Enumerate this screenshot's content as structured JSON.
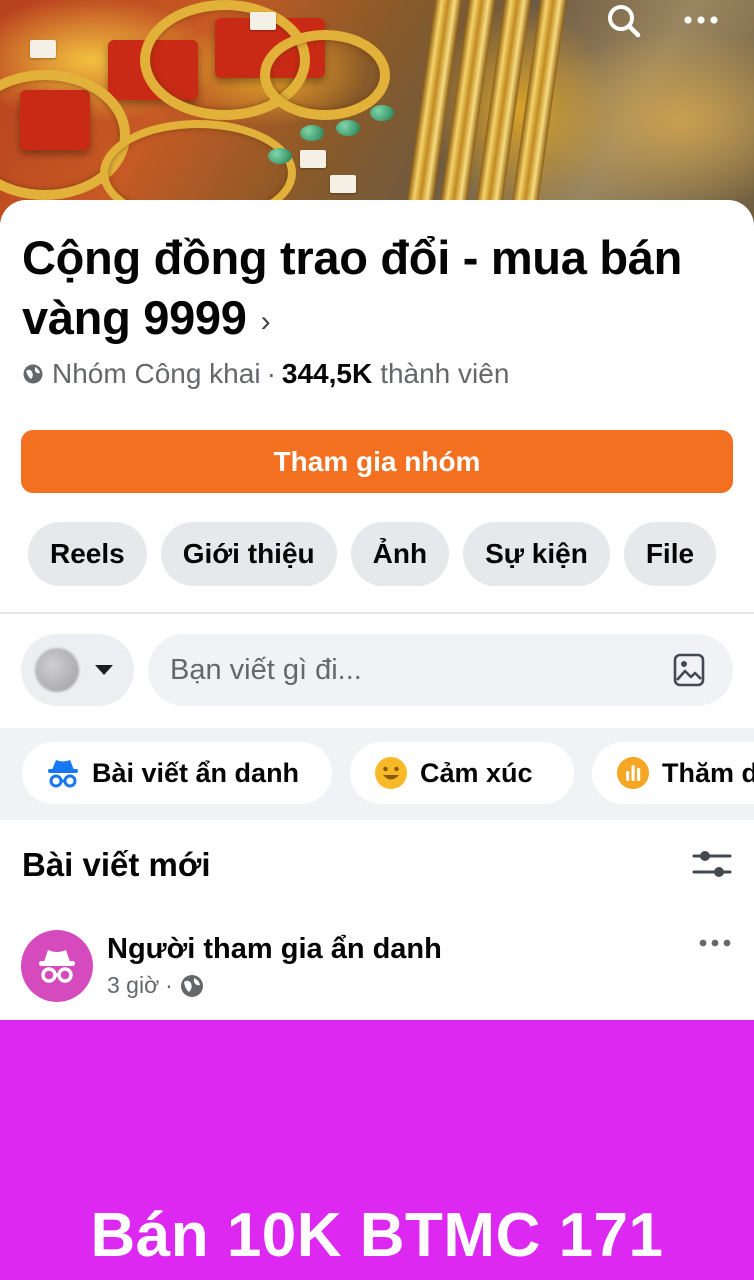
{
  "cover": {
    "alt": "gold jewelry photo"
  },
  "group": {
    "title_line1": "Cộng đồng trao đổi - mua bán",
    "title_line2": "vàng 9999",
    "chevron": "›",
    "privacy": "Nhóm Công khai",
    "separator": "·",
    "member_count": "344,5K",
    "member_label": "thành viên",
    "join_label": "Tham gia nhóm"
  },
  "tabs": [
    {
      "label": "Reels"
    },
    {
      "label": "Giới thiệu"
    },
    {
      "label": "Ảnh"
    },
    {
      "label": "Sự kiện"
    },
    {
      "label": "File"
    }
  ],
  "composer": {
    "placeholder": "Bạn viết gì đi..."
  },
  "actions": [
    {
      "label": "Bài viết ẩn danh",
      "icon": "anonymous-icon"
    },
    {
      "label": "Cảm xúc",
      "icon": "smiley-icon"
    },
    {
      "label": "Thăm dò",
      "icon": "poll-icon"
    }
  ],
  "feed": {
    "heading": "Bài viết mới"
  },
  "post": {
    "author": "Người tham gia ẩn danh",
    "time": "3 giờ",
    "separator": "·",
    "text": "Bán 10K BTMC 171",
    "background_color": "#dc28f1"
  },
  "colors": {
    "accent": "#f37021",
    "anonymous_avatar": "#d54bbd"
  }
}
